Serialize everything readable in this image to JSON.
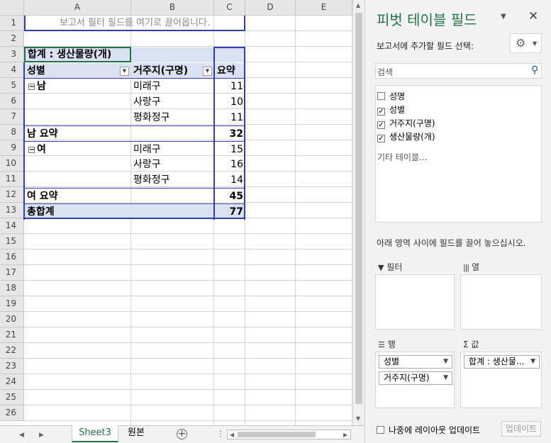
{
  "grid": {
    "columns": [
      "A",
      "B",
      "C",
      "D",
      "E"
    ],
    "rows": [
      "1",
      "2",
      "3",
      "4",
      "5",
      "6",
      "7",
      "8",
      "9",
      "10",
      "11",
      "12",
      "13",
      "14",
      "15",
      "16",
      "17",
      "18",
      "19",
      "20",
      "21",
      "22",
      "23",
      "24",
      "25",
      "26"
    ],
    "report_filter_placeholder": "보고서 필터 필드를 여기로 끌어옵니다.",
    "pivot_title": "합계 : 생산물량(개)",
    "header_gender": "성별",
    "header_residence": "거주지(구명)",
    "header_summary": "요약",
    "male_label": "남",
    "female_label": "여",
    "male_rows": [
      {
        "district": "미래구",
        "value": "11"
      },
      {
        "district": "사랑구",
        "value": "10"
      },
      {
        "district": "평화정구",
        "value": "11"
      }
    ],
    "female_rows": [
      {
        "district": "미래구",
        "value": "15"
      },
      {
        "district": "사랑구",
        "value": "16"
      },
      {
        "district": "평화정구",
        "value": "14"
      }
    ],
    "male_subtotal_label": "남 요약",
    "male_subtotal_value": "32",
    "female_subtotal_label": "여 요약",
    "female_subtotal_value": "45",
    "grand_total_label": "총합계",
    "grand_total_value": "77"
  },
  "tabs": {
    "sheet3": "Sheet3",
    "source": "원본",
    "add_icon": "plus-circle-icon"
  },
  "pane": {
    "title": "피벗 테이블 필드",
    "subtitle": "보고서에 추가할 필드 선택:",
    "search_placeholder": "검색",
    "fields": [
      {
        "label": "성명",
        "checked": false
      },
      {
        "label": "성별",
        "checked": true
      },
      {
        "label": "거주지(구명)",
        "checked": true
      },
      {
        "label": "생산물량(개)",
        "checked": true
      }
    ],
    "more_tables": "기타 테이블...",
    "drag_hint": "아래 영역 사이에 필드를 끌어 놓으십시오.",
    "area_filter": "필터",
    "area_columns": "열",
    "area_rows": "행",
    "area_values": "값",
    "row_pill_1": "성별",
    "row_pill_2": "거주지(구명)",
    "value_pill": "합계 : 생산물...",
    "defer_label": "나중에 레이아웃 업데이트",
    "update_button": "업데이트"
  },
  "colors": {
    "accent": "#217346",
    "pivot_header": "#d9e1f2",
    "pivot_border": "#2f3fb0"
  }
}
